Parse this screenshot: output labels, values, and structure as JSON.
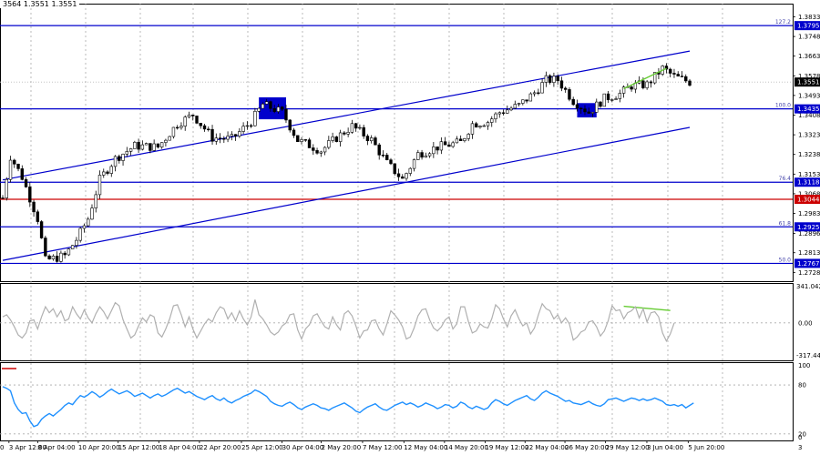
{
  "header": {
    "ohlc_text": "3564 1.3551 1.3551"
  },
  "chart_data": {
    "type": "candlestick",
    "price_axis": {
      "range": [
        1.269,
        1.389
      ],
      "ticks": [
        "1.3833",
        "1.3748",
        "1.3663",
        "1.3578",
        "1.3493",
        "1.3408",
        "1.3323",
        "1.3238",
        "1.3153",
        "1.3068",
        "1.2983",
        "1.2896",
        "1.2813",
        "1.2728"
      ]
    },
    "current_price": {
      "value": 1.3551,
      "label": "1.3551"
    },
    "fib_levels": [
      {
        "pct": "127.2",
        "value": 1.3795,
        "label": "1.3795",
        "color": "#0000cc"
      },
      {
        "pct": "100.0",
        "value": 1.3435,
        "label": "1.3435",
        "color": "#0000cc"
      },
      {
        "pct": "76.4",
        "value": 1.3118,
        "label": "1.3118",
        "color": "#0000cc"
      },
      {
        "pct": "61.8",
        "value": 1.2925,
        "label": "1.2925",
        "color": "#0000cc"
      },
      {
        "pct": "50.0",
        "value": 1.2767,
        "label": "1.2767",
        "color": "#0000cc"
      }
    ],
    "red_level": {
      "value": 1.3044,
      "label": "1.3044",
      "color": "#cc0000"
    },
    "channel_upper": [
      [
        0,
        1.3128
      ],
      [
        177,
        1.3685
      ]
    ],
    "channel_lower": [
      [
        0,
        1.278
      ],
      [
        177,
        1.3355
      ]
    ],
    "divergence_price": [
      [
        160,
        1.3522
      ],
      [
        171,
        1.361
      ]
    ],
    "zones": [
      {
        "i0": 66,
        "i1": 73,
        "lo": 1.339,
        "hi": 1.3485,
        "color": "#0000cc"
      },
      {
        "i0": 148,
        "i1": 153,
        "lo": 1.3398,
        "hi": 1.346,
        "color": "#0000cc"
      }
    ],
    "candles_count": 178,
    "close_path": [
      [
        0,
        1.305
      ],
      [
        2,
        1.323
      ],
      [
        5,
        1.314
      ],
      [
        9,
        1.296
      ],
      [
        11,
        1.278
      ],
      [
        16,
        1.28
      ],
      [
        19,
        1.287
      ],
      [
        22,
        1.296
      ],
      [
        25,
        1.313
      ],
      [
        29,
        1.322
      ],
      [
        34,
        1.3275
      ],
      [
        40,
        1.327
      ],
      [
        45,
        1.337
      ],
      [
        49,
        1.341
      ],
      [
        54,
        1.331
      ],
      [
        59,
        1.3305
      ],
      [
        64,
        1.338
      ],
      [
        67,
        1.3455
      ],
      [
        72,
        1.342
      ],
      [
        76,
        1.33
      ],
      [
        82,
        1.3255
      ],
      [
        86,
        1.331
      ],
      [
        90,
        1.336
      ],
      [
        95,
        1.33
      ],
      [
        99,
        1.32
      ],
      [
        103,
        1.313
      ],
      [
        107,
        1.324
      ],
      [
        112,
        1.327
      ],
      [
        118,
        1.329
      ],
      [
        121,
        1.337
      ],
      [
        125,
        1.338
      ],
      [
        128,
        1.342
      ],
      [
        133,
        1.345
      ],
      [
        137,
        1.3505
      ],
      [
        140,
        1.356
      ],
      [
        143,
        1.356
      ],
      [
        147,
        1.347
      ],
      [
        151,
        1.342
      ],
      [
        155,
        1.348
      ],
      [
        159,
        1.35
      ],
      [
        162,
        1.3535
      ],
      [
        166,
        1.354
      ],
      [
        170,
        1.361
      ],
      [
        173,
        1.3575
      ],
      [
        177,
        1.3551
      ]
    ],
    "x_axis": {
      "labels": [
        "3 Apr 12:00",
        "8 Apr 04:00",
        "10 Apr 20:00",
        "15 Apr 12:00",
        "18 Apr 04:00",
        "22 Apr 20:00",
        "25 Apr 12:00",
        "30 Apr 04:00",
        "2 May 20:00",
        "7 May 12:00",
        "12 May 04:00",
        "14 May 20:00",
        "19 May 12:00",
        "22 May 04:00",
        "26 May 20:00",
        "29 May 12:00",
        "3 Jun 04:00",
        "5 Jun 20:00"
      ],
      "left_fragment": "0",
      "bottom_right": "3"
    },
    "cci": {
      "range": [
        -317.444,
        341.0423
      ],
      "ticks": [
        "341.0423",
        "0.00",
        "-317.444"
      ],
      "values": [
        60,
        80,
        30,
        -40,
        -120,
        -150,
        -100,
        20,
        30,
        -60,
        60,
        160,
        100,
        140,
        60,
        120,
        20,
        40,
        160,
        90,
        40,
        130,
        50,
        0,
        90,
        160,
        110,
        40,
        120,
        200,
        170,
        30,
        -60,
        -150,
        -120,
        -30,
        50,
        10,
        80,
        60,
        -100,
        -140,
        -60,
        40,
        170,
        180,
        80,
        -40,
        60,
        -60,
        -150,
        -80,
        -10,
        40,
        10,
        100,
        160,
        140,
        40,
        100,
        20,
        120,
        40,
        -20,
        60,
        230,
        80,
        40,
        -20,
        -90,
        -120,
        -90,
        -30,
        0,
        80,
        90,
        -70,
        -160,
        -60,
        -20,
        70,
        90,
        20,
        -40,
        -60,
        60,
        -20,
        -70,
        90,
        120,
        70,
        -30,
        -150,
        -80,
        -70,
        20,
        30,
        -60,
        -120,
        -10,
        120,
        80,
        30,
        -40,
        -160,
        -140,
        -50,
        70,
        130,
        140,
        30,
        -50,
        -80,
        -40,
        30,
        60,
        -60,
        -10,
        160,
        160,
        10,
        -100,
        -80,
        -10,
        -40,
        -50,
        40,
        180,
        140,
        40,
        -40,
        70,
        130,
        40,
        -30,
        0,
        -110,
        -50,
        80,
        190,
        140,
        120,
        40,
        80,
        0,
        50,
        -10,
        -170,
        -140,
        -90,
        -70,
        10,
        20,
        -40,
        -130,
        -80,
        20,
        170,
        120,
        130,
        40,
        100,
        120,
        160,
        50,
        140,
        10,
        100,
        110,
        60,
        -100,
        -180,
        -110,
        0
      ],
      "divergence": [
        [
          160,
          165
        ],
        [
          172,
          123
        ]
      ]
    },
    "rsi": {
      "range": [
        12,
        108
      ],
      "ticks": [
        "100",
        "80",
        "20",
        "0"
      ],
      "values": [
        78,
        76,
        73,
        58,
        50,
        45,
        46,
        36,
        29,
        31,
        38,
        42,
        45,
        42,
        46,
        50,
        55,
        58,
        56,
        62,
        67,
        65,
        68,
        72,
        69,
        65,
        68,
        72,
        75,
        72,
        69,
        71,
        73,
        70,
        66,
        68,
        70,
        67,
        64,
        67,
        69,
        66,
        68,
        71,
        74,
        76,
        73,
        70,
        72,
        69,
        66,
        64,
        62,
        65,
        67,
        63,
        61,
        64,
        60,
        58,
        61,
        63,
        66,
        68,
        70,
        74,
        72,
        69,
        66,
        60,
        57,
        55,
        54,
        57,
        59,
        56,
        52,
        50,
        53,
        55,
        57,
        55,
        52,
        51,
        49,
        52,
        54,
        56,
        58,
        55,
        52,
        48,
        46,
        50,
        53,
        55,
        57,
        53,
        50,
        49,
        52,
        55,
        57,
        59,
        56,
        58,
        56,
        53,
        55,
        58,
        56,
        54,
        51,
        53,
        56,
        55,
        52,
        54,
        59,
        57,
        53,
        51,
        54,
        52,
        50,
        52,
        58,
        62,
        60,
        57,
        55,
        58,
        61,
        63,
        65,
        67,
        63,
        61,
        65,
        70,
        73,
        70,
        68,
        66,
        63,
        60,
        61,
        58,
        57,
        56,
        58,
        60,
        57,
        55,
        54,
        57,
        62,
        63,
        64,
        62,
        60,
        62,
        64,
        63,
        61,
        63,
        61,
        62,
        64,
        62,
        60,
        56,
        55,
        56,
        54,
        56,
        52,
        55,
        58
      ],
      "colors": {
        "line": "#1e90ff"
      }
    },
    "colors": {
      "candles": "#000000",
      "grid": "#aaaaaa",
      "cci_line": "#b0b0b0",
      "divergence": "#66cc33"
    }
  }
}
